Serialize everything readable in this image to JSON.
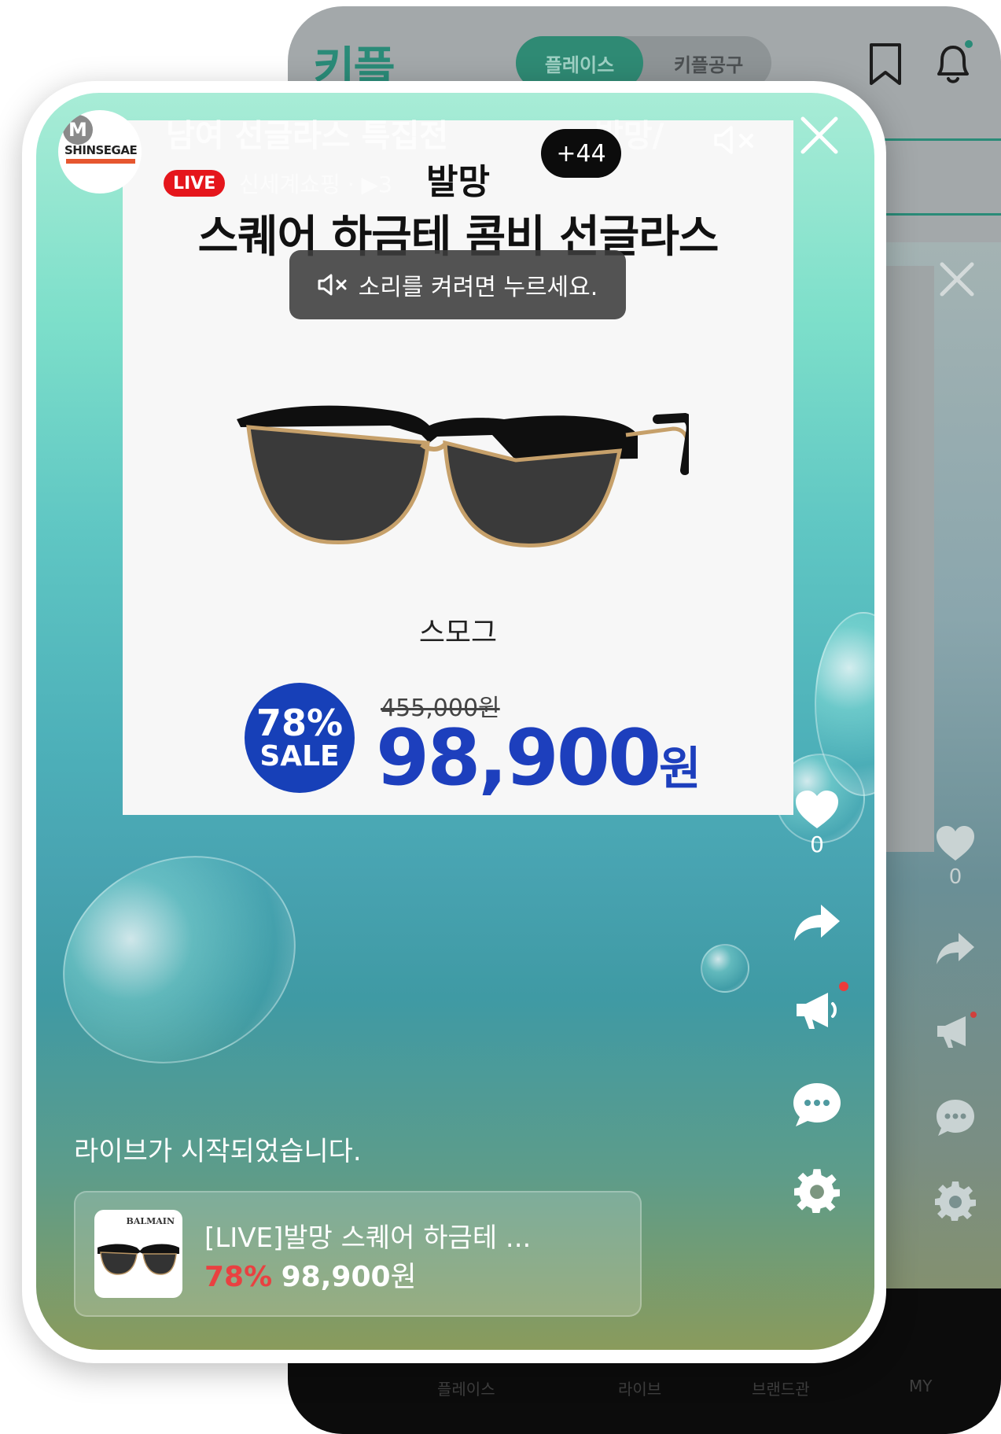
{
  "back_screen": {
    "logo": "키플",
    "tabs": [
      {
        "label": "플레이스",
        "active": true
      },
      {
        "label": "키플공구",
        "active": false
      }
    ],
    "like_count": "0",
    "nav_labels": [
      "플레이스",
      "라이브",
      "브랜드관",
      "MY"
    ]
  },
  "live": {
    "channel_avatar_letter": "M",
    "channel_avatar_text": "SHINSEGAE",
    "title": "남여 선글라스 특집전",
    "title_right": "발망/",
    "badge": "LIVE",
    "channel_meta": "신세계쇼핑 · ▶3"
  },
  "product_card": {
    "brand": "발망",
    "name": "스퀘어 하금테 콤비 선글라스",
    "color": "스모그",
    "sale_percent": "78%",
    "sale_label": "SALE",
    "original_price": "455,000원",
    "price_number": "98,900",
    "price_unit": "원"
  },
  "sound_toast": "소리를 켜려면 누르세요.",
  "rail": {
    "like_count": "0"
  },
  "chat": {
    "system_message": "라이브가 시작되었습니다."
  },
  "product_strip": {
    "thumb_brand": "BALMAIN",
    "title": "[LIVE]발망 스퀘어 하금테 ...",
    "discount": "78%",
    "price": "98,900",
    "price_unit": "원",
    "more_count": "+44"
  },
  "colors": {
    "accent_green": "#2a8b78",
    "live_red": "#e5161c",
    "price_blue": "#1d3fbd",
    "discount_red": "#e94141"
  }
}
